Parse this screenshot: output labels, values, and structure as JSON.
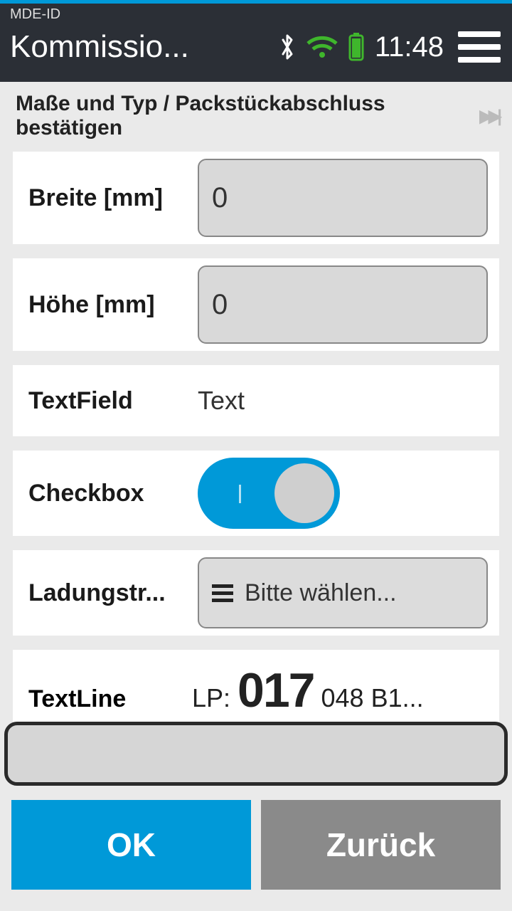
{
  "header": {
    "mde": "MDE-ID",
    "title": "Kommissio...",
    "time": "11:48"
  },
  "section_title": "Maße und Typ / Packstückabschluss bestätigen",
  "rows": {
    "breite": {
      "label": "Breite [mm]",
      "value": "0"
    },
    "hoehe": {
      "label": "Höhe [mm]",
      "value": "0"
    },
    "textfield": {
      "label": "TextField",
      "value": "Text"
    },
    "checkbox": {
      "label": "Checkbox"
    },
    "ladung": {
      "label": "Ladungstr...",
      "value": "Bitte wählen..."
    },
    "textline": {
      "label": "TextLine",
      "prefix": "LP: ",
      "big": "017",
      "suffix": " 048 B1..."
    }
  },
  "footer": {
    "ok": "OK",
    "back": "Zurück"
  }
}
